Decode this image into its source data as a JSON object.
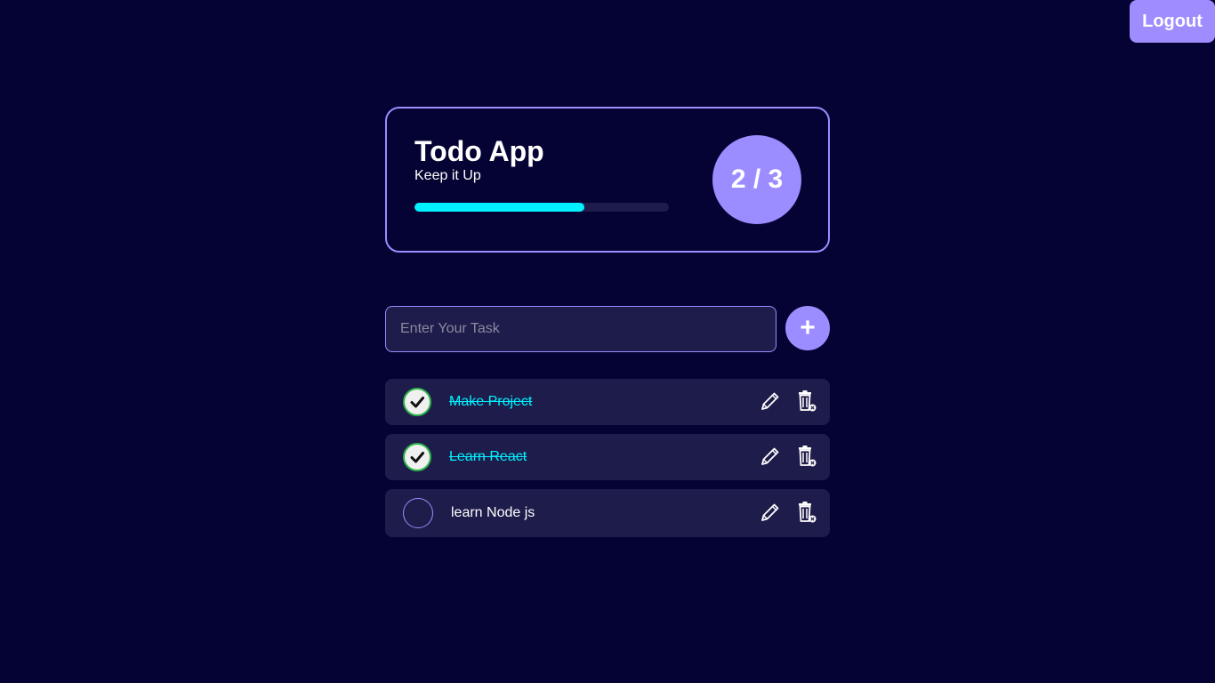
{
  "header": {
    "logout_label": "Logout"
  },
  "hero": {
    "title": "Todo App",
    "subtitle": "Keep it Up",
    "completed": 2,
    "total": 3,
    "counter_text": "2 / 3",
    "progress_fraction": 0.667
  },
  "input": {
    "placeholder": "Enter Your Task",
    "value": "",
    "add_label": "+"
  },
  "todos": [
    {
      "text": "Make Project",
      "completed": true
    },
    {
      "text": "Learn React",
      "completed": true
    },
    {
      "text": "learn Node js",
      "completed": false
    }
  ],
  "icons": {
    "edit": "pencil-icon",
    "delete": "trash-icon",
    "check": "checkmark-icon"
  },
  "colors": {
    "background": "#050333",
    "accent": "#9b8cff",
    "progress": "#00f2ff",
    "card": "#1e1c4a",
    "done_text": "#00f2ff",
    "check_ring": "#2bb34a"
  }
}
